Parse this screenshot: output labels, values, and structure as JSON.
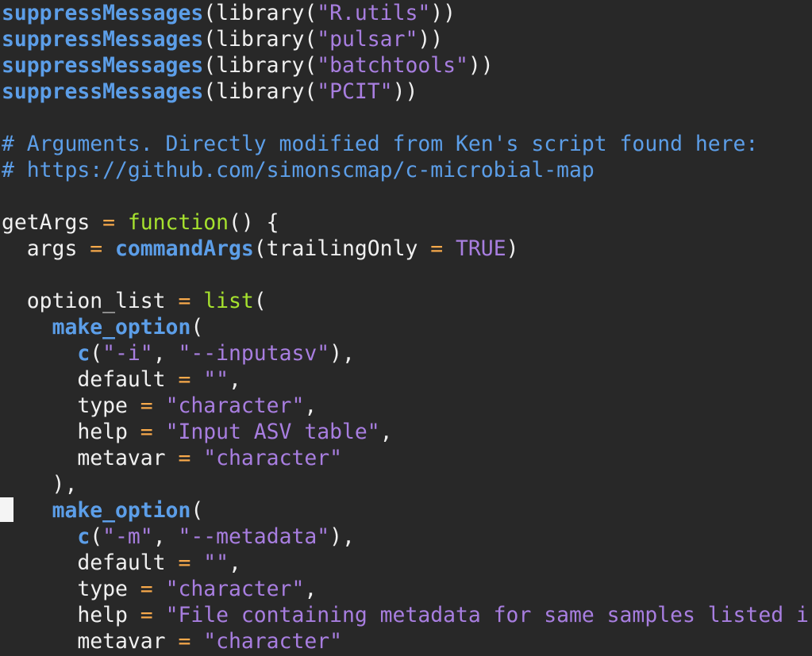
{
  "colors": {
    "background": "#282828",
    "plain": "#f0f0f0",
    "function": "#5c9ee8",
    "keyword": "#a6e22e",
    "string": "#a87ee0",
    "operator": "#f7a94b",
    "comment": "#5c9ee8",
    "constant": "#a87ee0"
  },
  "lines": [
    [
      [
        "fn",
        "suppressMessages"
      ],
      [
        "pl",
        "("
      ],
      [
        "pl",
        "library"
      ],
      [
        "pl",
        "("
      ],
      [
        "str",
        "\"R.utils\""
      ],
      [
        "pl",
        "))"
      ]
    ],
    [
      [
        "fn",
        "suppressMessages"
      ],
      [
        "pl",
        "("
      ],
      [
        "pl",
        "library"
      ],
      [
        "pl",
        "("
      ],
      [
        "str",
        "\"pulsar\""
      ],
      [
        "pl",
        "))"
      ]
    ],
    [
      [
        "fn",
        "suppressMessages"
      ],
      [
        "pl",
        "("
      ],
      [
        "pl",
        "library"
      ],
      [
        "pl",
        "("
      ],
      [
        "str",
        "\"batchtools\""
      ],
      [
        "pl",
        "))"
      ]
    ],
    [
      [
        "fn",
        "suppressMessages"
      ],
      [
        "pl",
        "("
      ],
      [
        "pl",
        "library"
      ],
      [
        "pl",
        "("
      ],
      [
        "str",
        "\"PCIT\""
      ],
      [
        "pl",
        "))"
      ]
    ],
    [],
    [
      [
        "cmt",
        "# Arguments. Directly modified from Ken's script found here:"
      ]
    ],
    [
      [
        "cmt",
        "# https://github.com/simonscmap/c-microbial-map"
      ]
    ],
    [],
    [
      [
        "pl",
        "getArgs "
      ],
      [
        "op",
        "="
      ],
      [
        "pl",
        " "
      ],
      [
        "kw",
        "function"
      ],
      [
        "pl",
        "() {"
      ]
    ],
    [
      [
        "pl",
        "  args "
      ],
      [
        "op",
        "="
      ],
      [
        "pl",
        " "
      ],
      [
        "fn",
        "commandArgs"
      ],
      [
        "pl",
        "(trailingOnly "
      ],
      [
        "op",
        "="
      ],
      [
        "pl",
        " "
      ],
      [
        "con",
        "TRUE"
      ],
      [
        "pl",
        ")"
      ]
    ],
    [],
    [
      [
        "pl",
        "  option_list "
      ],
      [
        "op",
        "="
      ],
      [
        "pl",
        " "
      ],
      [
        "kw",
        "list"
      ],
      [
        "pl",
        "("
      ]
    ],
    [
      [
        "pl",
        "    "
      ],
      [
        "fn",
        "make_option"
      ],
      [
        "pl",
        "("
      ]
    ],
    [
      [
        "pl",
        "      "
      ],
      [
        "fn",
        "c"
      ],
      [
        "pl",
        "("
      ],
      [
        "str",
        "\"-i\""
      ],
      [
        "pl",
        ", "
      ],
      [
        "str",
        "\"--inputasv\""
      ],
      [
        "pl",
        "),"
      ]
    ],
    [
      [
        "pl",
        "      default "
      ],
      [
        "op",
        "="
      ],
      [
        "pl",
        " "
      ],
      [
        "str",
        "\"\""
      ],
      [
        "pl",
        ","
      ]
    ],
    [
      [
        "pl",
        "      type "
      ],
      [
        "op",
        "="
      ],
      [
        "pl",
        " "
      ],
      [
        "str",
        "\"character\""
      ],
      [
        "pl",
        ","
      ]
    ],
    [
      [
        "pl",
        "      help "
      ],
      [
        "op",
        "="
      ],
      [
        "pl",
        " "
      ],
      [
        "str",
        "\"Input ASV table\""
      ],
      [
        "pl",
        ","
      ]
    ],
    [
      [
        "pl",
        "      metavar "
      ],
      [
        "op",
        "="
      ],
      [
        "pl",
        " "
      ],
      [
        "str",
        "\"character\""
      ]
    ],
    [
      [
        "pl",
        "    ),"
      ]
    ],
    [
      [
        "pl",
        "    "
      ],
      [
        "fn",
        "make_option"
      ],
      [
        "pl",
        "("
      ]
    ],
    [
      [
        "pl",
        "      "
      ],
      [
        "fn",
        "c"
      ],
      [
        "pl",
        "("
      ],
      [
        "str",
        "\"-m\""
      ],
      [
        "pl",
        ", "
      ],
      [
        "str",
        "\"--metadata\""
      ],
      [
        "pl",
        "),"
      ]
    ],
    [
      [
        "pl",
        "      default "
      ],
      [
        "op",
        "="
      ],
      [
        "pl",
        " "
      ],
      [
        "str",
        "\"\""
      ],
      [
        "pl",
        ","
      ]
    ],
    [
      [
        "pl",
        "      type "
      ],
      [
        "op",
        "="
      ],
      [
        "pl",
        " "
      ],
      [
        "str",
        "\"character\""
      ],
      [
        "pl",
        ","
      ]
    ],
    [
      [
        "pl",
        "      help "
      ],
      [
        "op",
        "="
      ],
      [
        "pl",
        " "
      ],
      [
        "str",
        "\"File containing metadata for same samples listed i"
      ]
    ],
    [
      [
        "pl",
        "      metavar "
      ],
      [
        "op",
        "="
      ],
      [
        "pl",
        " "
      ],
      [
        "str",
        "\"character\""
      ]
    ]
  ]
}
